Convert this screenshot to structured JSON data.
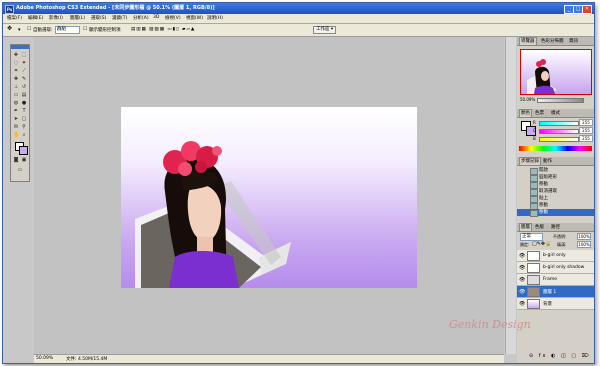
{
  "window": {
    "title": "Adobe Photoshop CS3 Extended - [未同步圖形檔 @ 50.1% (圖層 1, RGB/8)]",
    "controls": [
      "_",
      "□",
      "✕"
    ]
  },
  "menu": [
    "檔案(F)",
    "編輯(E)",
    "影像(I)",
    "圖層(L)",
    "選取(S)",
    "濾鏡(T)",
    "分析(A)",
    "3D",
    "檢視(V)",
    "視窗(W)",
    "說明(H)"
  ],
  "options": {
    "auto_select_label": "自動選取:",
    "auto_select_value": "群組",
    "show_transform_label": "顯示變形控制項",
    "workspace_label": "工作區 ▾"
  },
  "status": {
    "zoom": "50.09%",
    "doc_info": "文件: 4.50M/15.4M"
  },
  "navigator": {
    "tabs": [
      "導覽器",
      "色彩分佈圖",
      "資訊"
    ],
    "zoom": "50.09%"
  },
  "color": {
    "tabs": [
      "顏色",
      "色票",
      "樣式"
    ],
    "channels": [
      {
        "label": "R",
        "value": "255",
        "color": "#ff6a6a"
      },
      {
        "label": "G",
        "value": "255",
        "color": "#5cd65c"
      },
      {
        "label": "B",
        "value": "255",
        "color": "#6a8bff"
      }
    ]
  },
  "history": {
    "tabs": [
      "步驟記錄",
      "動作"
    ],
    "items": [
      "開啟",
      "圓角矩形",
      "移動",
      "取消選取",
      "貼上",
      "移動",
      "移動"
    ],
    "selected_index": 6
  },
  "layers": {
    "tabs": [
      "圖層",
      "色版",
      "路徑"
    ],
    "blend_mode": "正常",
    "opacity_label": "不透明:",
    "opacity": "100%",
    "lock_label": "鎖定:",
    "fill_label": "填滿:",
    "fill": "100%",
    "items": [
      {
        "name": "b-girl only",
        "visible": true
      },
      {
        "name": "b-girl only shadow",
        "visible": true
      },
      {
        "name": "Frame",
        "visible": true
      },
      {
        "name": "圖層 1",
        "visible": true
      },
      {
        "name": "背景",
        "visible": true
      }
    ],
    "selected_index": 3
  },
  "watermark": "Genkin Design",
  "colors": {
    "accent": "#316ac5",
    "purple": "#b68cec"
  }
}
